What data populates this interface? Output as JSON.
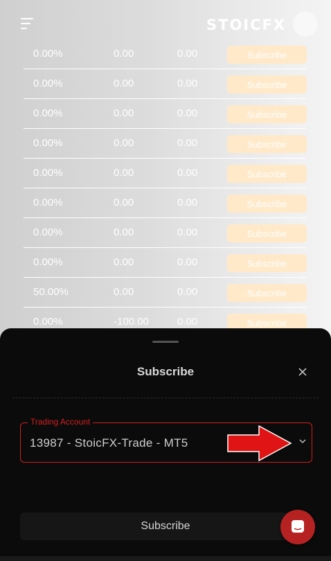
{
  "header": {
    "logo_text": "STOICFX"
  },
  "table": {
    "rows": [
      {
        "col1": "0.00%",
        "col2": "0.00",
        "col3": "0.00",
        "action": "Subscribe"
      },
      {
        "col1": "0.00%",
        "col2": "0.00",
        "col3": "0.00",
        "action": "Subscribe"
      },
      {
        "col1": "0.00%",
        "col2": "0.00",
        "col3": "0.00",
        "action": "Subscribe"
      },
      {
        "col1": "0.00%",
        "col2": "0.00",
        "col3": "0.00",
        "action": "Subscribe"
      },
      {
        "col1": "0.00%",
        "col2": "0.00",
        "col3": "0.00",
        "action": "Subscribe"
      },
      {
        "col1": "0.00%",
        "col2": "0.00",
        "col3": "0.00",
        "action": "Subscribe"
      },
      {
        "col1": "0.00%",
        "col2": "0.00",
        "col3": "0.00",
        "action": "Subscribe"
      },
      {
        "col1": "0.00%",
        "col2": "0.00",
        "col3": "0.00",
        "action": "Subscribe"
      },
      {
        "col1": "50.00%",
        "col2": "0.00",
        "col3": "0.00",
        "action": "Subscribe"
      },
      {
        "col1": "0.00%",
        "col2": "-100.00",
        "col3": "0.00",
        "action": "Subscribe"
      }
    ]
  },
  "sheet": {
    "title": "Subscribe",
    "field_label": "Trading Account",
    "field_value": "13987 - StoicFX-Trade - MT5",
    "primary_button": "Subscribe"
  },
  "colors": {
    "accent_red": "#d11f1f",
    "subscribe_bg": "#ffe6c2",
    "sheet_bg": "#0b0b0b"
  },
  "icons": {
    "menu": "menu-icon",
    "close": "close-icon",
    "chevron": "chevron-down-icon",
    "arrow": "arrow-right-icon",
    "chat": "chat-icon"
  }
}
